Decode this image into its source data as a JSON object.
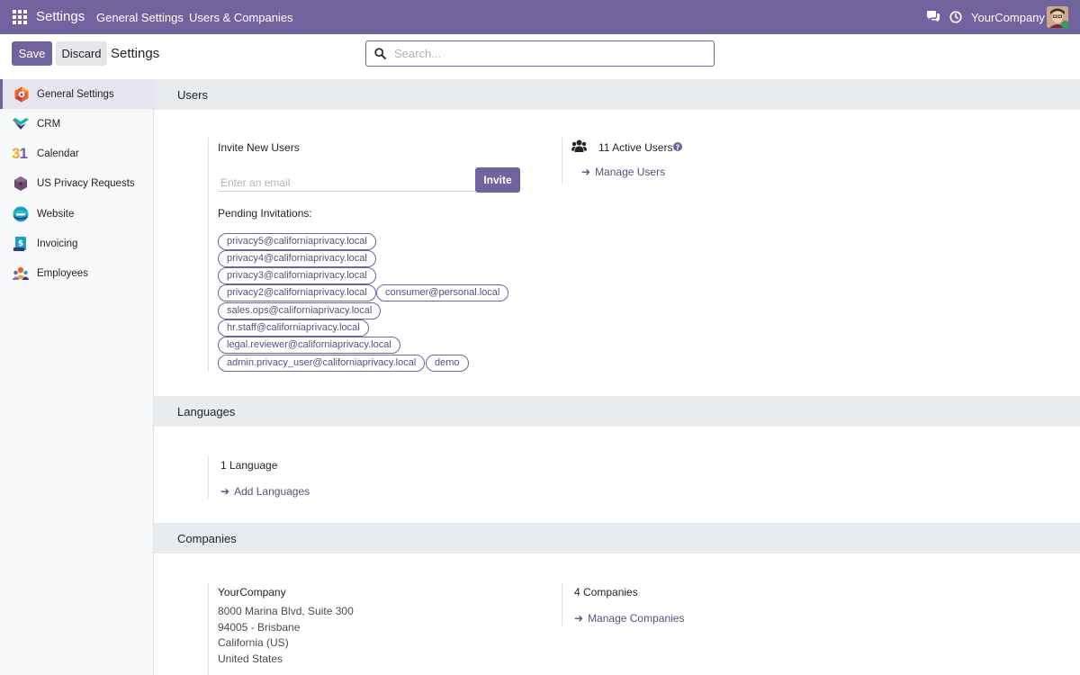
{
  "navbar": {
    "app_name": "Settings",
    "menu": [
      "General Settings",
      "Users & Companies"
    ],
    "company": "YourCompany",
    "icons": [
      "apps-grid-icon",
      "chat-icon",
      "clock-icon"
    ]
  },
  "control_panel": {
    "save_label": "Save",
    "discard_label": "Discard",
    "title": "Settings",
    "search_placeholder": "Search..."
  },
  "sidebar": {
    "items": [
      {
        "label": "General Settings",
        "icon": "general-settings-icon",
        "active": true
      },
      {
        "label": "CRM",
        "icon": "crm-icon"
      },
      {
        "label": "Calendar",
        "icon": "calendar-icon"
      },
      {
        "label": "US Privacy Requests",
        "icon": "privacy-icon"
      },
      {
        "label": "Website",
        "icon": "website-icon"
      },
      {
        "label": "Invoicing",
        "icon": "invoicing-icon"
      },
      {
        "label": "Employees",
        "icon": "employees-icon"
      }
    ]
  },
  "users": {
    "heading": "Users",
    "invite_title": "Invite New Users",
    "email_placeholder": "Enter an email",
    "invite_label": "Invite",
    "pending_title": "Pending Invitations:",
    "pending": [
      "privacy5@californiaprivacy.local",
      "privacy4@californiaprivacy.local",
      "privacy3@californiaprivacy.local",
      "privacy2@californiaprivacy.local",
      "consumer@personal.local",
      "sales.ops@californiaprivacy.local",
      "hr.staff@californiaprivacy.local",
      "legal.reviewer@californiaprivacy.local",
      "admin.privacy_user@californiaprivacy.local",
      "demo"
    ],
    "active_users": "11 Active Users",
    "manage_users": "Manage Users"
  },
  "languages": {
    "heading": "Languages",
    "count": "1 Language",
    "add_label": "Add Languages"
  },
  "companies": {
    "heading": "Companies",
    "name": "YourCompany",
    "address": [
      "8000 Marina Blvd, Suite 300",
      "94005 - Brisbane",
      "California (US)",
      "United States"
    ],
    "count": "4 Companies",
    "manage_label": "Manage Companies"
  },
  "colors": {
    "brand": "#71639e",
    "link": "#5a4f7f"
  }
}
